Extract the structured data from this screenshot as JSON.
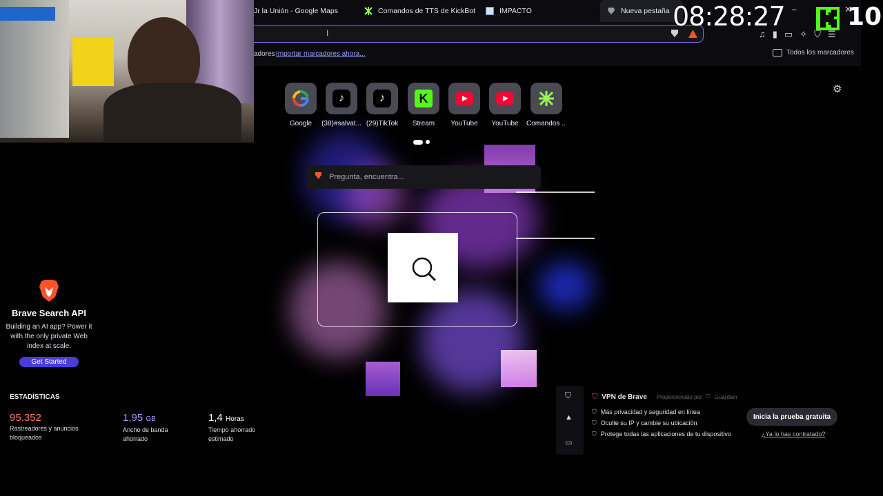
{
  "tabs": [
    {
      "label": "Jr la Unión - Google Maps",
      "icon": "maps-icon"
    },
    {
      "label": "Comandos de TTS de KickBot",
      "icon": "kickbot-icon"
    },
    {
      "label": "IMPACTO",
      "icon": "page-icon"
    },
    {
      "label": "Nueva pestaña",
      "icon": "brave-icon",
      "active": true
    }
  ],
  "bookmarks": {
    "prefix": "adores",
    "import_link": "Importar marcadores ahora...",
    "all_bookmarks": "Todos los marcadores"
  },
  "overlay": {
    "timer": "08:28:27",
    "kick_count": "10"
  },
  "top_sites": [
    {
      "label": "Google",
      "icon": "google-icon"
    },
    {
      "label": "(38)#salvat...",
      "icon": "tiktok-icon"
    },
    {
      "label": "(29)TikTok",
      "icon": "tiktok-icon"
    },
    {
      "label": "Stream",
      "icon": "kick-icon"
    },
    {
      "label": "YouTube",
      "icon": "youtube-icon"
    },
    {
      "label": "YouTube",
      "icon": "youtube-icon"
    },
    {
      "label": "Comandos ...",
      "icon": "kickbot-icon"
    }
  ],
  "search": {
    "placeholder": "Pregunta, encuentra..."
  },
  "api_card": {
    "title": "Brave Search API",
    "body": "Building an AI app? Power it with the only private Web index at scale.",
    "cta": "Get Started"
  },
  "stats": {
    "title": "ESTADÍSTICAS",
    "items": [
      {
        "value": "95.352",
        "unit": "",
        "label": "Rastreadores y anuncios bloqueados",
        "color": "#ff7a5c"
      },
      {
        "value": "1,95",
        "unit": "GB",
        "label": "Ancho de banda ahorrado",
        "color": "#a69cff"
      },
      {
        "value": "1,4",
        "unit": "Horas",
        "label": "Tiempo ahorrado estimado",
        "color": "#ffffff"
      }
    ]
  },
  "vpn": {
    "title": "VPN de Brave",
    "provider": "Proporcionado por",
    "provider_name": "Guardian",
    "features": [
      "Más privacidad y seguridad en línea",
      "Oculte su IP y cambie su ubicación",
      "Protege todas las aplicaciones de tu dispositivo"
    ],
    "cta": "Inicia la prueba gratuita",
    "link": "¿Ya lo has contratado?"
  },
  "colors": {
    "accent": "#7c6cf0",
    "brave": "#fb542b",
    "kick": "#53fc18",
    "youtube": "#ff0033"
  }
}
